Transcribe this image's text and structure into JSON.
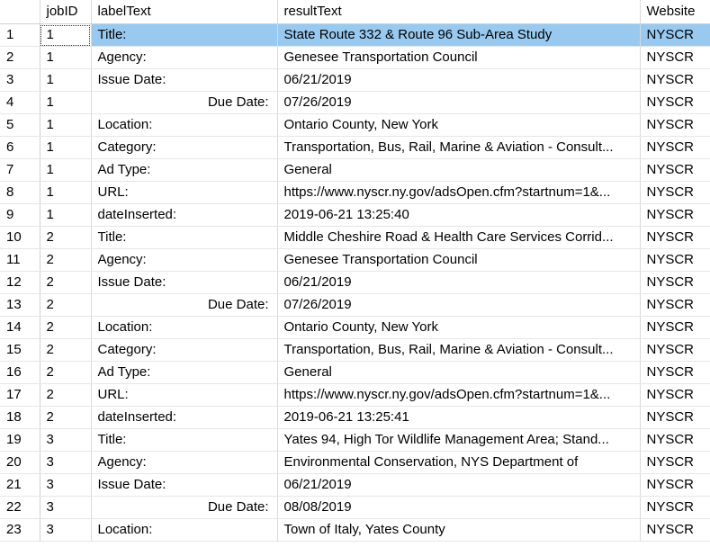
{
  "columns": [
    "",
    "jobID",
    "labelText",
    "resultText",
    "Website"
  ],
  "rows": [
    {
      "n": "1",
      "job": "1",
      "label": "Title:",
      "result": "State Route 332 & Route 96 Sub-Area Study",
      "site": "NYSCR",
      "right": false
    },
    {
      "n": "2",
      "job": "1",
      "label": "Agency:",
      "result": "Genesee Transportation Council",
      "site": "NYSCR",
      "right": false
    },
    {
      "n": "3",
      "job": "1",
      "label": "Issue Date:",
      "result": "06/21/2019",
      "site": "NYSCR",
      "right": false
    },
    {
      "n": "4",
      "job": "1",
      "label": "Due Date:",
      "result": "07/26/2019",
      "site": "NYSCR",
      "right": true
    },
    {
      "n": "5",
      "job": "1",
      "label": "Location:",
      "result": "Ontario County, New York",
      "site": "NYSCR",
      "right": false
    },
    {
      "n": "6",
      "job": "1",
      "label": "Category:",
      "result": "Transportation, Bus, Rail, Marine & Aviation - Consult...",
      "site": "NYSCR",
      "right": false
    },
    {
      "n": "7",
      "job": "1",
      "label": "Ad Type:",
      "result": "General",
      "site": "NYSCR",
      "right": false
    },
    {
      "n": "8",
      "job": "1",
      "label": "URL:",
      "result": "https://www.nyscr.ny.gov/adsOpen.cfm?startnum=1&...",
      "site": "NYSCR",
      "right": false
    },
    {
      "n": "9",
      "job": "1",
      "label": "dateInserted:",
      "result": "2019-06-21 13:25:40",
      "site": "NYSCR",
      "right": false
    },
    {
      "n": "10",
      "job": "2",
      "label": "Title:",
      "result": "Middle Cheshire Road & Health Care Services Corrid...",
      "site": "NYSCR",
      "right": false
    },
    {
      "n": "11",
      "job": "2",
      "label": "Agency:",
      "result": "Genesee Transportation Council",
      "site": "NYSCR",
      "right": false
    },
    {
      "n": "12",
      "job": "2",
      "label": "Issue Date:",
      "result": "06/21/2019",
      "site": "NYSCR",
      "right": false
    },
    {
      "n": "13",
      "job": "2",
      "label": "Due Date:",
      "result": "07/26/2019",
      "site": "NYSCR",
      "right": true
    },
    {
      "n": "14",
      "job": "2",
      "label": "Location:",
      "result": "Ontario County, New York",
      "site": "NYSCR",
      "right": false
    },
    {
      "n": "15",
      "job": "2",
      "label": "Category:",
      "result": "Transportation, Bus, Rail, Marine & Aviation - Consult...",
      "site": "NYSCR",
      "right": false
    },
    {
      "n": "16",
      "job": "2",
      "label": "Ad Type:",
      "result": "General",
      "site": "NYSCR",
      "right": false
    },
    {
      "n": "17",
      "job": "2",
      "label": "URL:",
      "result": "https://www.nyscr.ny.gov/adsOpen.cfm?startnum=1&...",
      "site": "NYSCR",
      "right": false
    },
    {
      "n": "18",
      "job": "2",
      "label": "dateInserted:",
      "result": "2019-06-21 13:25:41",
      "site": "NYSCR",
      "right": false
    },
    {
      "n": "19",
      "job": "3",
      "label": "Title:",
      "result": "Yates 94, High Tor Wildlife Management Area; Stand...",
      "site": "NYSCR",
      "right": false
    },
    {
      "n": "20",
      "job": "3",
      "label": "Agency:",
      "result": "Environmental Conservation, NYS Department of",
      "site": "NYSCR",
      "right": false
    },
    {
      "n": "21",
      "job": "3",
      "label": "Issue Date:",
      "result": "06/21/2019",
      "site": "NYSCR",
      "right": false
    },
    {
      "n": "22",
      "job": "3",
      "label": "Due Date:",
      "result": "08/08/2019",
      "site": "NYSCR",
      "right": true
    },
    {
      "n": "23",
      "job": "3",
      "label": "Location:",
      "result": "Town of Italy, Yates County",
      "site": "NYSCR",
      "right": false
    }
  ]
}
